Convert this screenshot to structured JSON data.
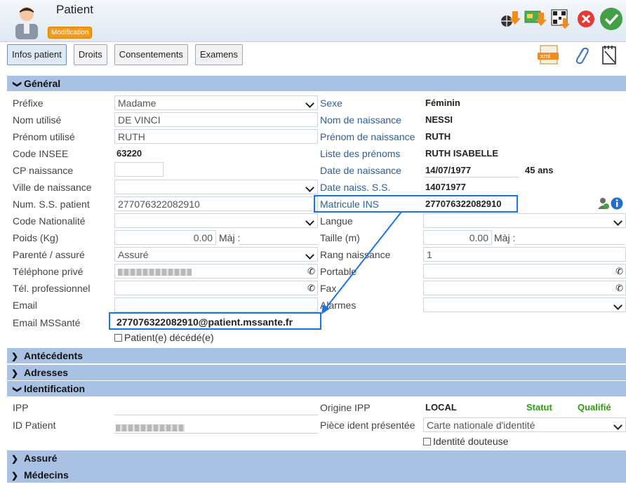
{
  "header": {
    "title": "Patient",
    "mode": "Modification"
  },
  "tabs": [
    "Infos patient",
    "Droits",
    "Consentements",
    "Examens"
  ],
  "tools": {
    "xml": "xml"
  },
  "sections": {
    "general": "Général",
    "antecedents": "Antécédents",
    "adresses": "Adresses",
    "identification": "Identification",
    "assure": "Assuré",
    "medecins": "Médecins"
  },
  "general": {
    "prefixe": {
      "label": "Préfixe",
      "value": "Madame"
    },
    "nom_utilise": {
      "label": "Nom utilisé",
      "value": "DE VINCI"
    },
    "prenom_utilise": {
      "label": "Prénom utilisé",
      "value": "RUTH"
    },
    "code_insee": {
      "label": "Code INSEE",
      "value": "63220"
    },
    "cp_naissance": {
      "label": "CP naissance",
      "value": ""
    },
    "ville_naissance": {
      "label": "Ville de naissance",
      "value": ""
    },
    "num_ss": {
      "label": "Num. S.S. patient",
      "value": "277076322082910"
    },
    "code_nationalite": {
      "label": "Code Nationalité",
      "value": ""
    },
    "poids": {
      "label": "Poids (Kg)",
      "value": "0.00",
      "maj": "Màj :"
    },
    "parente": {
      "label": "Parenté / assuré",
      "value": "Assuré"
    },
    "tel_prive": {
      "label": "Téléphone privé"
    },
    "tel_pro": {
      "label": "Tél. professionnel",
      "value": ""
    },
    "email": {
      "label": "Email",
      "value": ""
    },
    "email_mss": {
      "label": "Email MSSanté",
      "value": "277076322082910@patient.mssante.fr"
    },
    "decede": "Patient(e) décédé(e)",
    "sexe": {
      "label": "Sexe",
      "value": "Féminin"
    },
    "nom_naissance": {
      "label": "Nom de naissance",
      "value": "NESSI"
    },
    "prenom_naissance": {
      "label": "Prénom de naissance",
      "value": "RUTH"
    },
    "liste_prenoms": {
      "label": "Liste des prénoms",
      "value": "RUTH ISABELLE"
    },
    "date_naissance": {
      "label": "Date de naissance",
      "value": "14/07/1977",
      "age": "45 ans"
    },
    "date_naiss_ss": {
      "label": "Date naiss. S.S.",
      "value": "14071977"
    },
    "matricule_ins": {
      "label": "Matricule INS",
      "value": "277076322082910"
    },
    "langue": {
      "label": "Langue",
      "value": ""
    },
    "taille": {
      "label": "Taille (m)",
      "value": "0.00",
      "maj": "Màj :"
    },
    "rang_naissance": {
      "label": "Rang naissance",
      "value": "1"
    },
    "portable": {
      "label": "Portable",
      "value": ""
    },
    "fax": {
      "label": "Fax",
      "value": ""
    },
    "alarmes": {
      "label": "Alarmes",
      "value": ""
    }
  },
  "identification": {
    "ipp": {
      "label": "IPP",
      "value": ""
    },
    "id_patient": {
      "label": "ID Patient"
    },
    "origine_ipp": {
      "label": "Origine IPP",
      "value": "LOCAL"
    },
    "statut": {
      "label": "Statut",
      "value": "Qualifié"
    },
    "piece": {
      "label": "Pièce ident présentée",
      "value": "Carte nationale d'identité"
    },
    "identite_douteuse": "Identité douteuse"
  },
  "colors": {
    "section": "#a9c2e3",
    "highlight": "#1a73e8",
    "label_blue": "#2a5fa8",
    "status_green": "#2e9a16"
  }
}
